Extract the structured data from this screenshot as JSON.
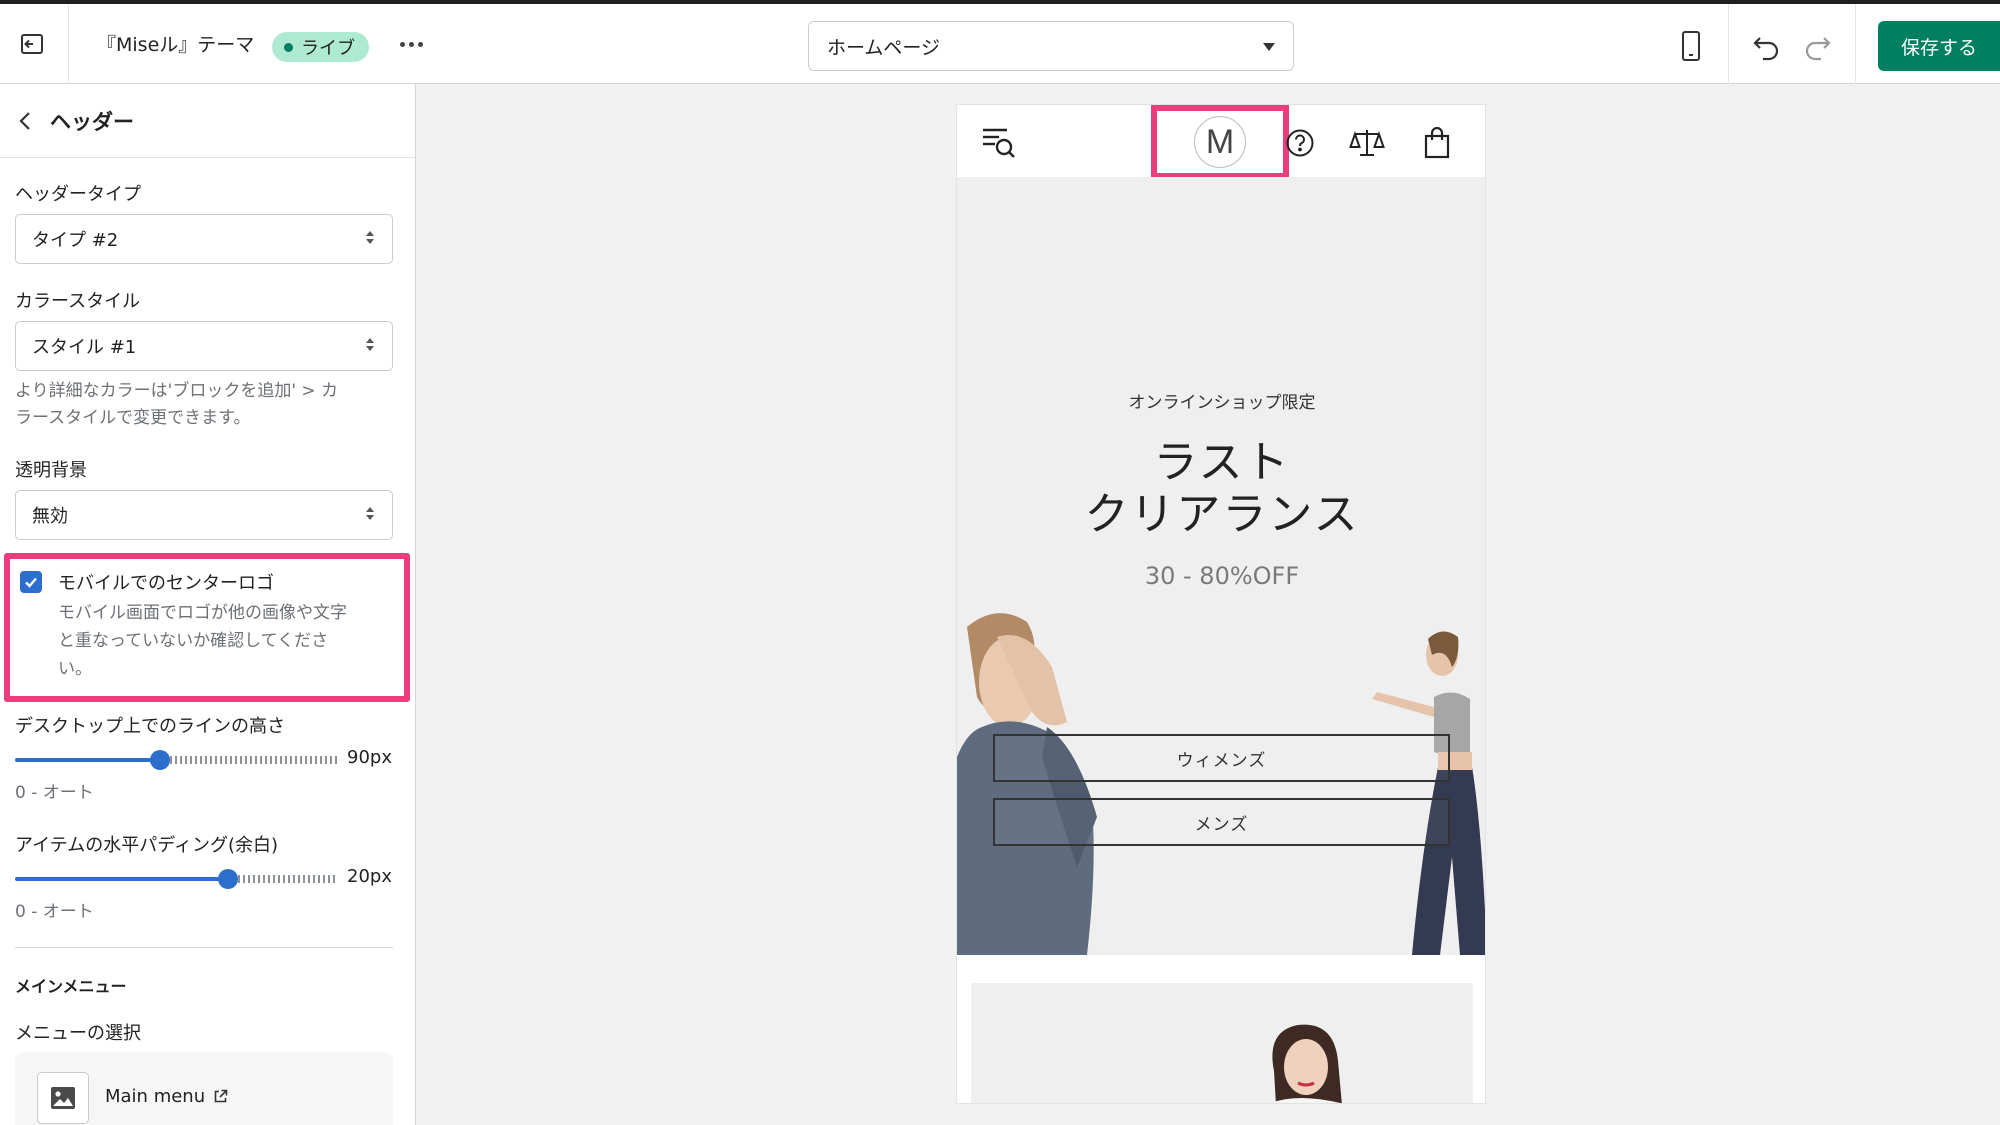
{
  "topbar": {
    "theme_name": "『Miseル』テーマ",
    "live_badge": "ライブ",
    "page_select_value": "ホームページ",
    "save_label": "保存する"
  },
  "sidebar": {
    "back_title": "ヘッダー",
    "header_type": {
      "label": "ヘッダータイプ",
      "value": "タイプ #2"
    },
    "color_style": {
      "label": "カラースタイル",
      "value": "スタイル #1",
      "help_line1": "より詳細なカラーは'ブロックを追加' > カ",
      "help_line2": "ラースタイルで変更できます。"
    },
    "transparent_bg": {
      "label": "透明背景",
      "value": "無効"
    },
    "center_logo": {
      "label": "モバイルでのセンターロゴ",
      "checked": true,
      "help_line1": "モバイル画面でロゴが他の画像や文字",
      "help_line2": "と重なっていないか確認してくださ",
      "help_line3": "い。"
    },
    "line_height": {
      "label": "デスクトップ上でのラインの高さ",
      "value": "90px",
      "level": 0.45,
      "help": "0 - オート"
    },
    "item_padding": {
      "label": "アイテムの水平パディング(余白)",
      "value": "20px",
      "level": 0.66,
      "help": "0 - オート"
    },
    "main_menu": {
      "heading": "メインメニュー",
      "select_label": "メニューの選択",
      "menu_name": "Main menu"
    }
  },
  "preview": {
    "logo_letter": "M",
    "hero": {
      "eyebrow": "オンラインショップ限定",
      "title_line1": "ラスト",
      "title_line2": "クリアランス",
      "subtitle": "30 - 80%OFF",
      "button_women": "ウィメンズ",
      "button_men": "メンズ"
    }
  },
  "colors": {
    "accent_blue": "#2c6ecb",
    "save_green": "#008060",
    "highlight_pink": "#ea3d7e",
    "live_badge_bg": "#aee9d1"
  }
}
